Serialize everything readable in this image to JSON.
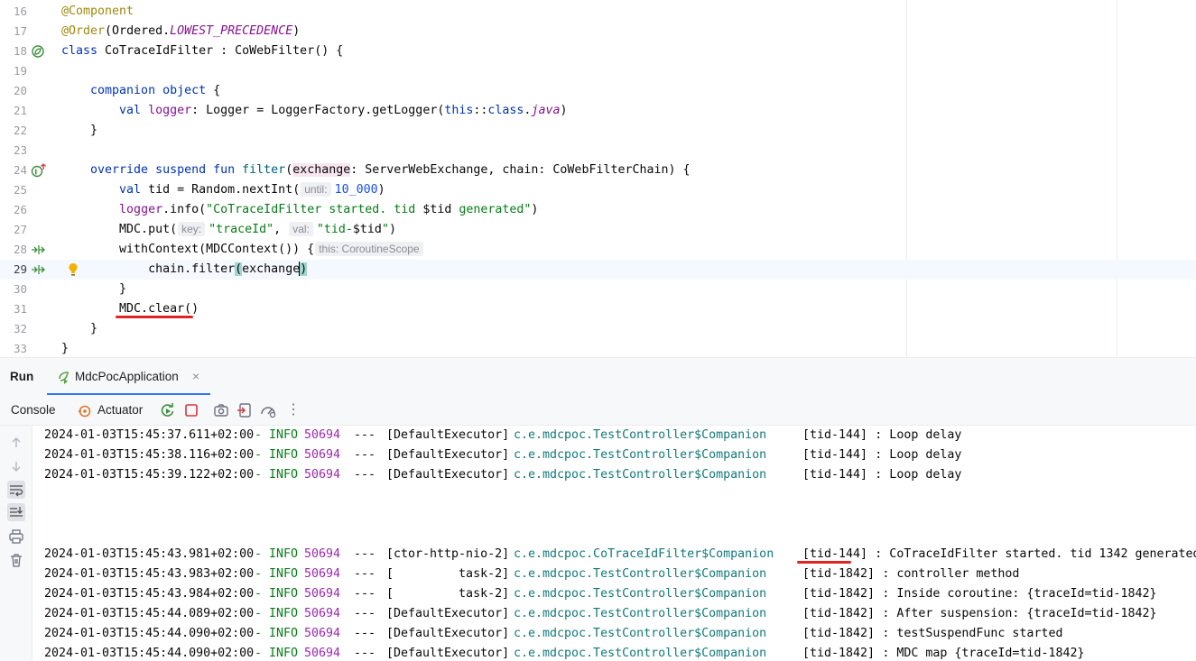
{
  "editor": {
    "lines": [
      {
        "num": "16",
        "segments": [
          {
            "t": "@Component",
            "c": "ann"
          }
        ]
      },
      {
        "num": "17",
        "segments": [
          {
            "t": "@Order",
            "c": "ann"
          },
          {
            "t": "(Ordered.",
            "c": ""
          },
          {
            "t": "LOWEST_PRECEDENCE",
            "c": "const"
          },
          {
            "t": ")",
            "c": ""
          }
        ]
      },
      {
        "num": "18",
        "gutter": "bean-icon",
        "segments": [
          {
            "t": "class",
            "c": "kw"
          },
          {
            "t": " CoTraceIdFilter : CoWebFilter() {",
            "c": ""
          }
        ]
      },
      {
        "num": "19",
        "segments": []
      },
      {
        "num": "20",
        "segments": [
          {
            "t": "    companion object",
            "c": "kw"
          },
          {
            "t": " {",
            "c": ""
          }
        ]
      },
      {
        "num": "21",
        "segments": [
          {
            "t": "        ",
            "c": ""
          },
          {
            "t": "val",
            "c": "kw"
          },
          {
            "t": " ",
            "c": ""
          },
          {
            "t": "logger",
            "c": "prop"
          },
          {
            "t": ": Logger = LoggerFactory.getLogger(",
            "c": ""
          },
          {
            "t": "this",
            "c": "kw"
          },
          {
            "t": "::",
            "c": ""
          },
          {
            "t": "class",
            "c": "kw"
          },
          {
            "t": ".",
            "c": ""
          },
          {
            "t": "java",
            "c": "java"
          },
          {
            "t": ")",
            "c": ""
          }
        ]
      },
      {
        "num": "22",
        "segments": [
          {
            "t": "    }",
            "c": ""
          }
        ]
      },
      {
        "num": "23",
        "segments": []
      },
      {
        "num": "24",
        "gutter": "override-icon",
        "segments": [
          {
            "t": "    override suspend fun",
            "c": "kw"
          },
          {
            "t": " ",
            "c": ""
          },
          {
            "t": "filter",
            "c": "fnname"
          },
          {
            "t": "(",
            "c": ""
          },
          {
            "t": "exchange",
            "c": "param-hl"
          },
          {
            "t": ": ServerWebExchange, chain: CoWebFilterChain) {",
            "c": ""
          }
        ]
      },
      {
        "num": "25",
        "segments": [
          {
            "t": "        ",
            "c": ""
          },
          {
            "t": "val",
            "c": "kw"
          },
          {
            "t": " tid = Random.nextInt(",
            "c": ""
          },
          {
            "hint": "until:"
          },
          {
            "t": "10_000",
            "c": "num"
          },
          {
            "t": ")",
            "c": ""
          }
        ]
      },
      {
        "num": "26",
        "segments": [
          {
            "t": "        ",
            "c": ""
          },
          {
            "t": "logger",
            "c": "prop"
          },
          {
            "t": ".info(",
            "c": ""
          },
          {
            "t": "\"CoTraceIdFilter started. tid ",
            "c": "str"
          },
          {
            "t": "$tid",
            "c": ""
          },
          {
            "t": " generated\"",
            "c": "str"
          },
          {
            "t": ")",
            "c": ""
          }
        ]
      },
      {
        "num": "27",
        "segments": [
          {
            "t": "        MDC.put(",
            "c": ""
          },
          {
            "hint": "key:"
          },
          {
            "t": "\"traceId\"",
            "c": "str"
          },
          {
            "t": ", ",
            "c": ""
          },
          {
            "hint": "val:"
          },
          {
            "t": "\"tid-",
            "c": "str"
          },
          {
            "t": "$tid",
            "c": ""
          },
          {
            "t": "\"",
            "c": "str"
          },
          {
            "t": ")",
            "c": ""
          }
        ]
      },
      {
        "num": "28",
        "gutter": "suspend-call-icon",
        "segments": [
          {
            "t": "        withContext(MDCContext()) {",
            "c": ""
          },
          {
            "hint": "this: CoroutineScope"
          }
        ]
      },
      {
        "num": "29",
        "gutter": "suspend-call-icon",
        "current": true,
        "bulb": true,
        "segments": [
          {
            "t": "            chain.filter",
            "c": ""
          },
          {
            "t": "(",
            "c": "paren-hl"
          },
          {
            "t": "exchange",
            "c": ""
          },
          {
            "caret": true
          },
          {
            "t": ")",
            "c": "paren-hl"
          }
        ]
      },
      {
        "num": "30",
        "segments": [
          {
            "t": "        }",
            "c": ""
          }
        ]
      },
      {
        "num": "31",
        "segments": [
          {
            "t": "        MDC.clear()",
            "c": ""
          }
        ]
      },
      {
        "num": "32",
        "segments": [
          {
            "t": "    }",
            "c": ""
          }
        ]
      },
      {
        "num": "33",
        "segments": [
          {
            "t": "}",
            "c": ""
          }
        ]
      }
    ]
  },
  "run_window": {
    "title": "Run",
    "tab_label": "MdcPocApplication",
    "tab_close": "×",
    "console_tab": "Console",
    "actuator_tab": "Actuator",
    "toolbar_icons": [
      "rerun-icon",
      "stop-icon",
      "screenshot-icon",
      "export-icon",
      "dashboard-icon",
      "more-icon"
    ],
    "more_glyph": "⋮"
  },
  "console": {
    "lines": [
      {
        "ts": "2024-01-03T15:45:37.611+02:00",
        "level": "INFO",
        "pid": "50694",
        "sep": "---",
        "thread": "[DefaultExecutor]",
        "logger": "c.e.mdcpoc.TestController$Companion",
        "tid": "[tid-144]",
        "msg": ": Loop delay"
      },
      {
        "ts": "2024-01-03T15:45:38.116+02:00",
        "level": "INFO",
        "pid": "50694",
        "sep": "---",
        "thread": "[DefaultExecutor]",
        "logger": "c.e.mdcpoc.TestController$Companion",
        "tid": "[tid-144]",
        "msg": ": Loop delay"
      },
      {
        "ts": "2024-01-03T15:45:39.122+02:00",
        "level": "INFO",
        "pid": "50694",
        "sep": "---",
        "thread": "[DefaultExecutor]",
        "logger": "c.e.mdcpoc.TestController$Companion",
        "tid": "[tid-144]",
        "msg": ": Loop delay"
      },
      {
        "ts": "2024-01-03T15:45:43.981+02:00",
        "level": "INFO",
        "pid": "50694",
        "sep": "---",
        "thread": "[ctor-http-nio-2]",
        "logger": "c.e.mdcpoc.CoTraceIdFilter$Companion",
        "tid": "[tid-144]",
        "msg": ": CoTraceIdFilter started. tid 1342 generated"
      },
      {
        "ts": "2024-01-03T15:45:43.983+02:00",
        "level": "INFO",
        "pid": "50694",
        "sep": "---",
        "thread": "[         task-2]",
        "logger": "c.e.mdcpoc.TestController$Companion",
        "tid": "[tid-1842]",
        "msg": ": controller method"
      },
      {
        "ts": "2024-01-03T15:45:43.984+02:00",
        "level": "INFO",
        "pid": "50694",
        "sep": "---",
        "thread": "[         task-2]",
        "logger": "c.e.mdcpoc.TestController$Companion",
        "tid": "[tid-1842]",
        "msg": ": Inside coroutine: {traceId=tid-1842}"
      },
      {
        "ts": "2024-01-03T15:45:44.089+02:00",
        "level": "INFO",
        "pid": "50694",
        "sep": "---",
        "thread": "[DefaultExecutor]",
        "logger": "c.e.mdcpoc.TestController$Companion",
        "tid": "[tid-1842]",
        "msg": ": After suspension: {traceId=tid-1842}"
      },
      {
        "ts": "2024-01-03T15:45:44.090+02:00",
        "level": "INFO",
        "pid": "50694",
        "sep": "---",
        "thread": "[DefaultExecutor]",
        "logger": "c.e.mdcpoc.TestController$Companion",
        "tid": "[tid-1842]",
        "msg": ": testSuspendFunc started"
      },
      {
        "ts": "2024-01-03T15:45:44.090+02:00",
        "level": "INFO",
        "pid": "50694",
        "sep": "---",
        "thread": "[DefaultExecutor]",
        "logger": "c.e.mdcpoc.TestController$Companion",
        "tid": "[tid-1842]",
        "msg": ": MDC map {traceId=tid-1842}"
      }
    ]
  },
  "colors": {
    "accent": "#3574f0",
    "annotation_red": "#e02424",
    "keyword": "#0033b3",
    "string": "#067d17"
  }
}
